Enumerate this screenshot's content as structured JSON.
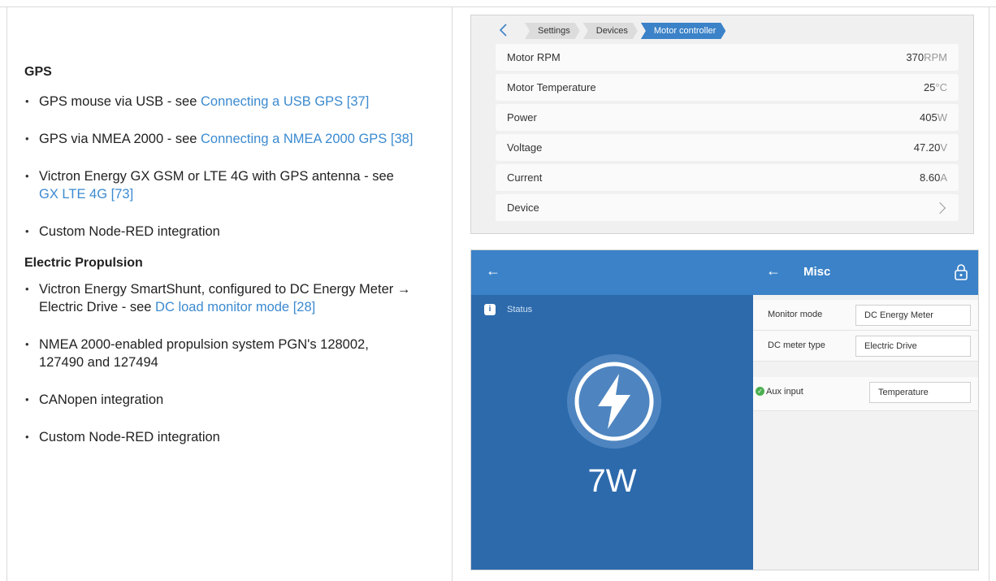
{
  "left": {
    "gps_heading": "GPS",
    "gps_items": [
      {
        "text": "GPS mouse via USB - see ",
        "link": "Connecting a USB GPS [37]"
      },
      {
        "text": "GPS via NMEA 2000 - see ",
        "link": "Connecting a NMEA 2000 GPS [38]"
      },
      {
        "text": "Victron Energy GX GSM or LTE 4G with GPS antenna - see ",
        "link": "GX LTE 4G [73]"
      },
      {
        "text": "Custom Node-RED integration",
        "link": ""
      }
    ],
    "prop_heading": "Electric Propulsion",
    "prop_items": [
      {
        "text": "Victron Energy SmartShunt, configured to DC Energy Meter → Electric Drive - see ",
        "link": "DC load monitor mode [28]"
      },
      {
        "text": "NMEA 2000-enabled propulsion system PGN's 128002, 127490 and 127494",
        "link": ""
      },
      {
        "text": "CANopen integration",
        "link": ""
      },
      {
        "text": "Custom Node-RED integration",
        "link": ""
      }
    ]
  },
  "motor_screen": {
    "back_icon": "chevron-left-icon",
    "breadcrumbs": [
      "Settings",
      "Devices",
      "Motor controller"
    ],
    "rows": [
      {
        "label": "Motor RPM",
        "value": "370",
        "unit": "RPM"
      },
      {
        "label": "Motor Temperature",
        "value": "25",
        "unit": "°C"
      },
      {
        "label": "Power",
        "value": "405",
        "unit": "W"
      },
      {
        "label": "Voltage",
        "value": "47.20",
        "unit": "V"
      },
      {
        "label": "Current",
        "value": "8.60",
        "unit": "A"
      },
      {
        "label": "Device",
        "value": "",
        "unit": ""
      }
    ]
  },
  "misc_screen": {
    "left_back": "←",
    "right_back": "←",
    "title": "Misc",
    "status_label": "Status",
    "power_value": "7W",
    "fields": [
      {
        "label": "Monitor mode",
        "value": "DC Energy Meter"
      },
      {
        "label": "DC meter type",
        "value": "Electric Drive"
      },
      {
        "label": "Aux input",
        "value": "Temperature"
      }
    ],
    "colors": {
      "header_blue": "#3b82c8",
      "pane_blue": "#2c6aac",
      "link_blue": "#3b8ad0"
    }
  }
}
